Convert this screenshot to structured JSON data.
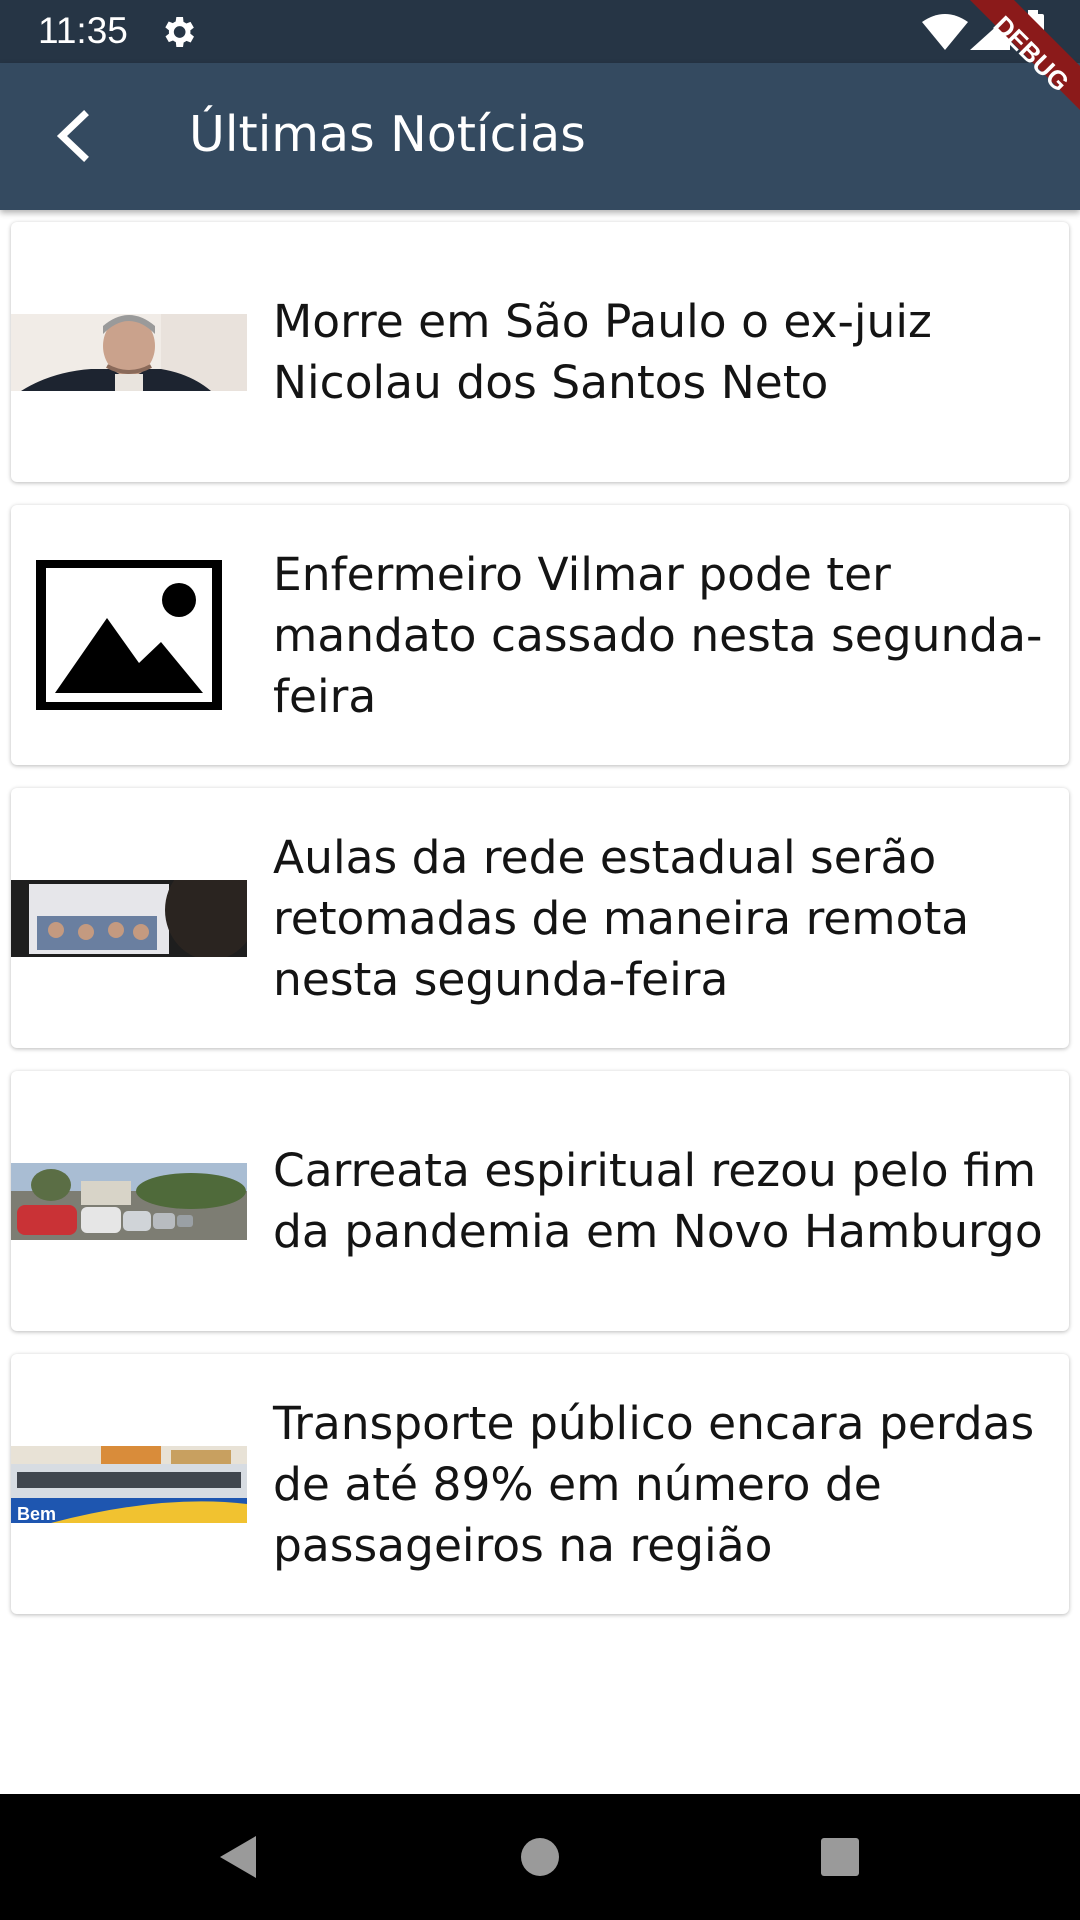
{
  "status_bar": {
    "time": "11:35",
    "icons": [
      "settings-gear-icon",
      "wifi-icon",
      "cell-signal-icon",
      "battery-icon"
    ]
  },
  "app_bar": {
    "title": "Últimas Notícias",
    "back_icon": "arrow-back-icon",
    "color": "#344a60"
  },
  "debug_banner": {
    "label": "DEBUG",
    "color": "#8b1a1a"
  },
  "news": [
    {
      "headline": "Morre em São Paulo o ex-juiz Nicolau dos Santos Neto",
      "thumbnail": "portrait-photo"
    },
    {
      "headline": "Enfermeiro Vilmar pode ter mandato cassado nesta segunda-feira",
      "thumbnail": "image-placeholder-icon"
    },
    {
      "headline": "Aulas da rede estadual serão retomadas de maneira remota nesta segunda-feira",
      "thumbnail": "classroom-screen-photo"
    },
    {
      "headline": "Carreata espiritual rezou pelo fim da pandemia em Novo Hamburgo",
      "thumbnail": "car-procession-photo"
    },
    {
      "headline": "Transporte público encara perdas de até 89% em número de passageiros na região",
      "thumbnail": "bus-photo"
    }
  ],
  "nav_bar": {
    "buttons": [
      "back-triangle-icon",
      "home-circle-icon",
      "recents-square-icon"
    ]
  }
}
